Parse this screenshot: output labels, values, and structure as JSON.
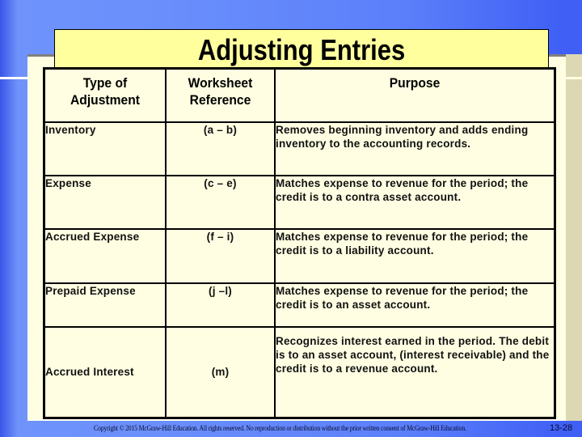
{
  "slide": {
    "title": "Adjusting Entries",
    "colors": {
      "background_blue": "#5b7ffa",
      "panel_cream": "#fffee2",
      "title_yellow": "#ffff9e",
      "right_strip": "#dcd8b4"
    }
  },
  "table": {
    "headers": [
      "Type of Adjustment",
      "Worksheet Reference",
      "Purpose"
    ],
    "rows": [
      {
        "type": "Inventory",
        "reference": "(a – b)",
        "purpose": "Removes beginning inventory and adds ending inventory to the accounting records."
      },
      {
        "type": "Expense",
        "reference": "(c – e)",
        "purpose": "Matches expense to revenue for the period; the credit is to a contra asset account."
      },
      {
        "type": "Accrued Expense",
        "reference": "(f – i)",
        "purpose": "Matches expense to revenue for the period; the credit is to a liability account."
      },
      {
        "type": "Prepaid Expense",
        "reference": "(j –l)",
        "purpose": "Matches expense to revenue for the period; the credit is to an asset account."
      },
      {
        "type": "Accrued Interest",
        "reference": "(m)",
        "purpose": "Recognizes interest earned in the period. The debit is to an asset account, (interest receivable) and the credit is to a revenue account."
      }
    ]
  },
  "footer": {
    "copyright": "Copyright © 2015 McGraw-Hill Education. All rights reserved. No reproduction or distribution without the prior written consent of McGraw-Hill Education.",
    "page_number": "13-28"
  }
}
